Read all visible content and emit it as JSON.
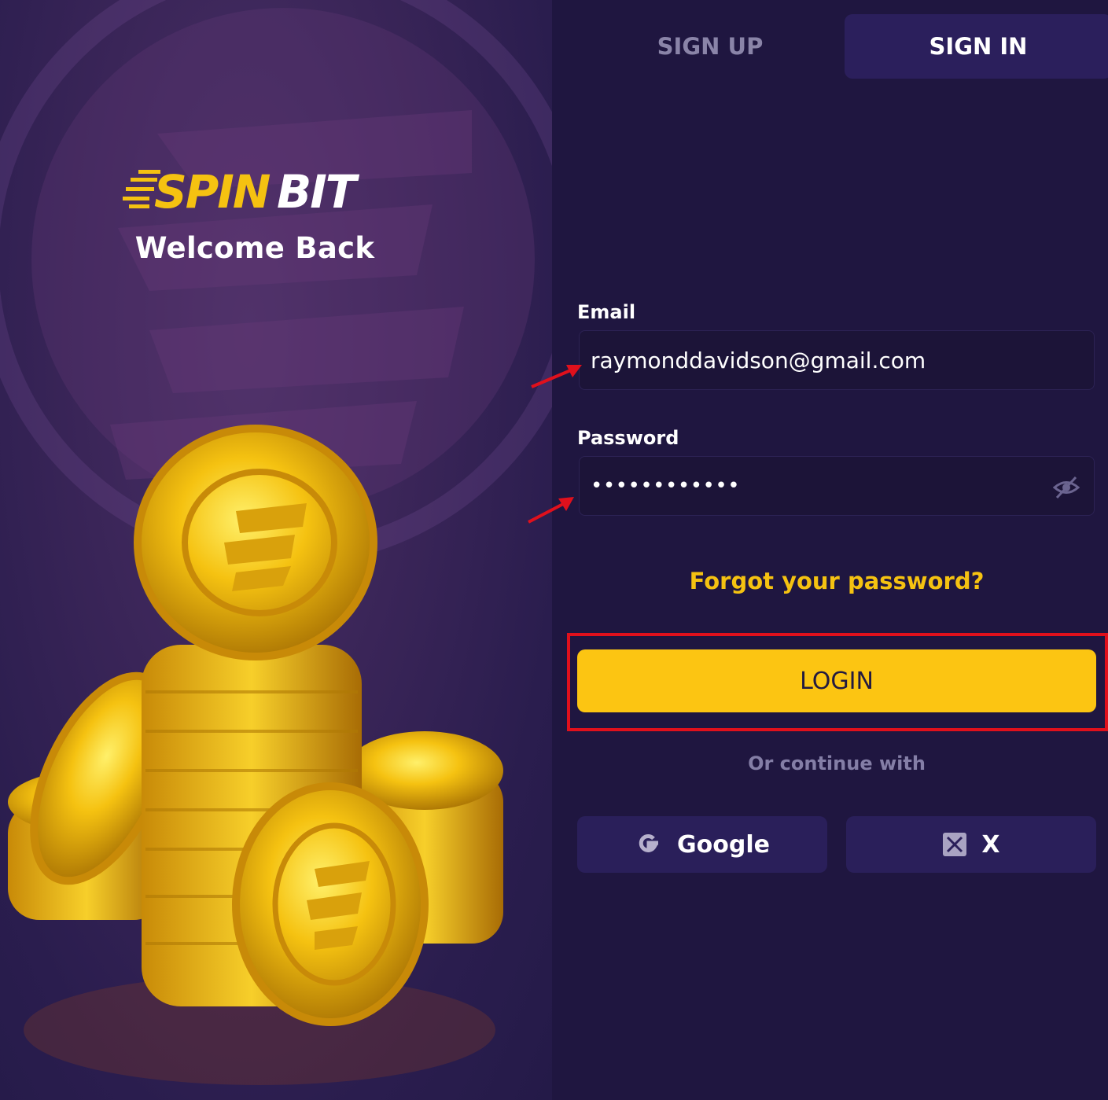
{
  "brand": {
    "logo_text": "SPINBIT",
    "welcome": "Welcome Back"
  },
  "tabs": [
    {
      "label": "SIGN UP",
      "active": false
    },
    {
      "label": "SIGN IN",
      "active": true
    }
  ],
  "form": {
    "email_label": "Email",
    "email_value": "raymonddavidson@gmail.com",
    "password_label": "Password",
    "password_value": "••••••••••••",
    "forgot_label": "Forgot your password?",
    "login_label": "LOGIN",
    "or_label": "Or continue with"
  },
  "social": [
    {
      "label": "Google",
      "icon": "google-icon"
    },
    {
      "label": "X",
      "icon": "x-icon"
    }
  ],
  "colors": {
    "background": "#1f1640",
    "accent": "#fcc512",
    "tab_active": "#2b1f5c",
    "annotation": "#e0101c"
  }
}
